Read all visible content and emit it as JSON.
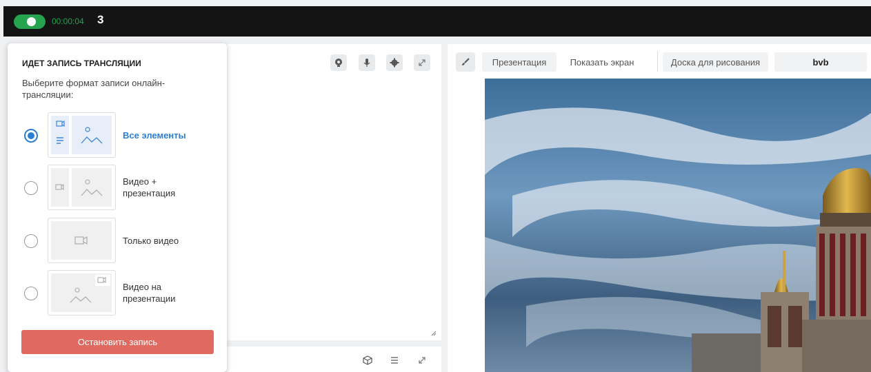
{
  "topbar": {
    "timer": "00:00:04",
    "count": "3",
    "toggle_on": true,
    "accent": "#25a34f"
  },
  "video_panel": {
    "icons": [
      "webcam-icon",
      "microphone-icon",
      "settings-icon",
      "expand-icon"
    ]
  },
  "bottom_panel": {
    "icons": [
      "cube-icon",
      "menu-icon",
      "expand-icon"
    ]
  },
  "toolbar": {
    "tabs": [
      {
        "label": "Презентация",
        "boxed": true
      },
      {
        "label": "Показать экран",
        "boxed": false
      },
      {
        "label": "Доска для рисования",
        "boxed": true
      },
      {
        "label": "bvb",
        "boxed": true
      }
    ]
  },
  "dropdown": {
    "title": "ИДЕТ ЗАПИСЬ ТРАНСЛЯЦИИ",
    "subtitle": "Выберите формат записи онлайн-трансляции:",
    "options": [
      {
        "label": "Все элементы",
        "checked": true
      },
      {
        "label": "Видео + презентация",
        "checked": false
      },
      {
        "label": "Только видео",
        "checked": false
      },
      {
        "label": "Видео на презентации",
        "checked": false
      }
    ],
    "stop_label": "Остановить запись",
    "stop_color": "#e06a60",
    "active_color": "#2a7fd4"
  }
}
